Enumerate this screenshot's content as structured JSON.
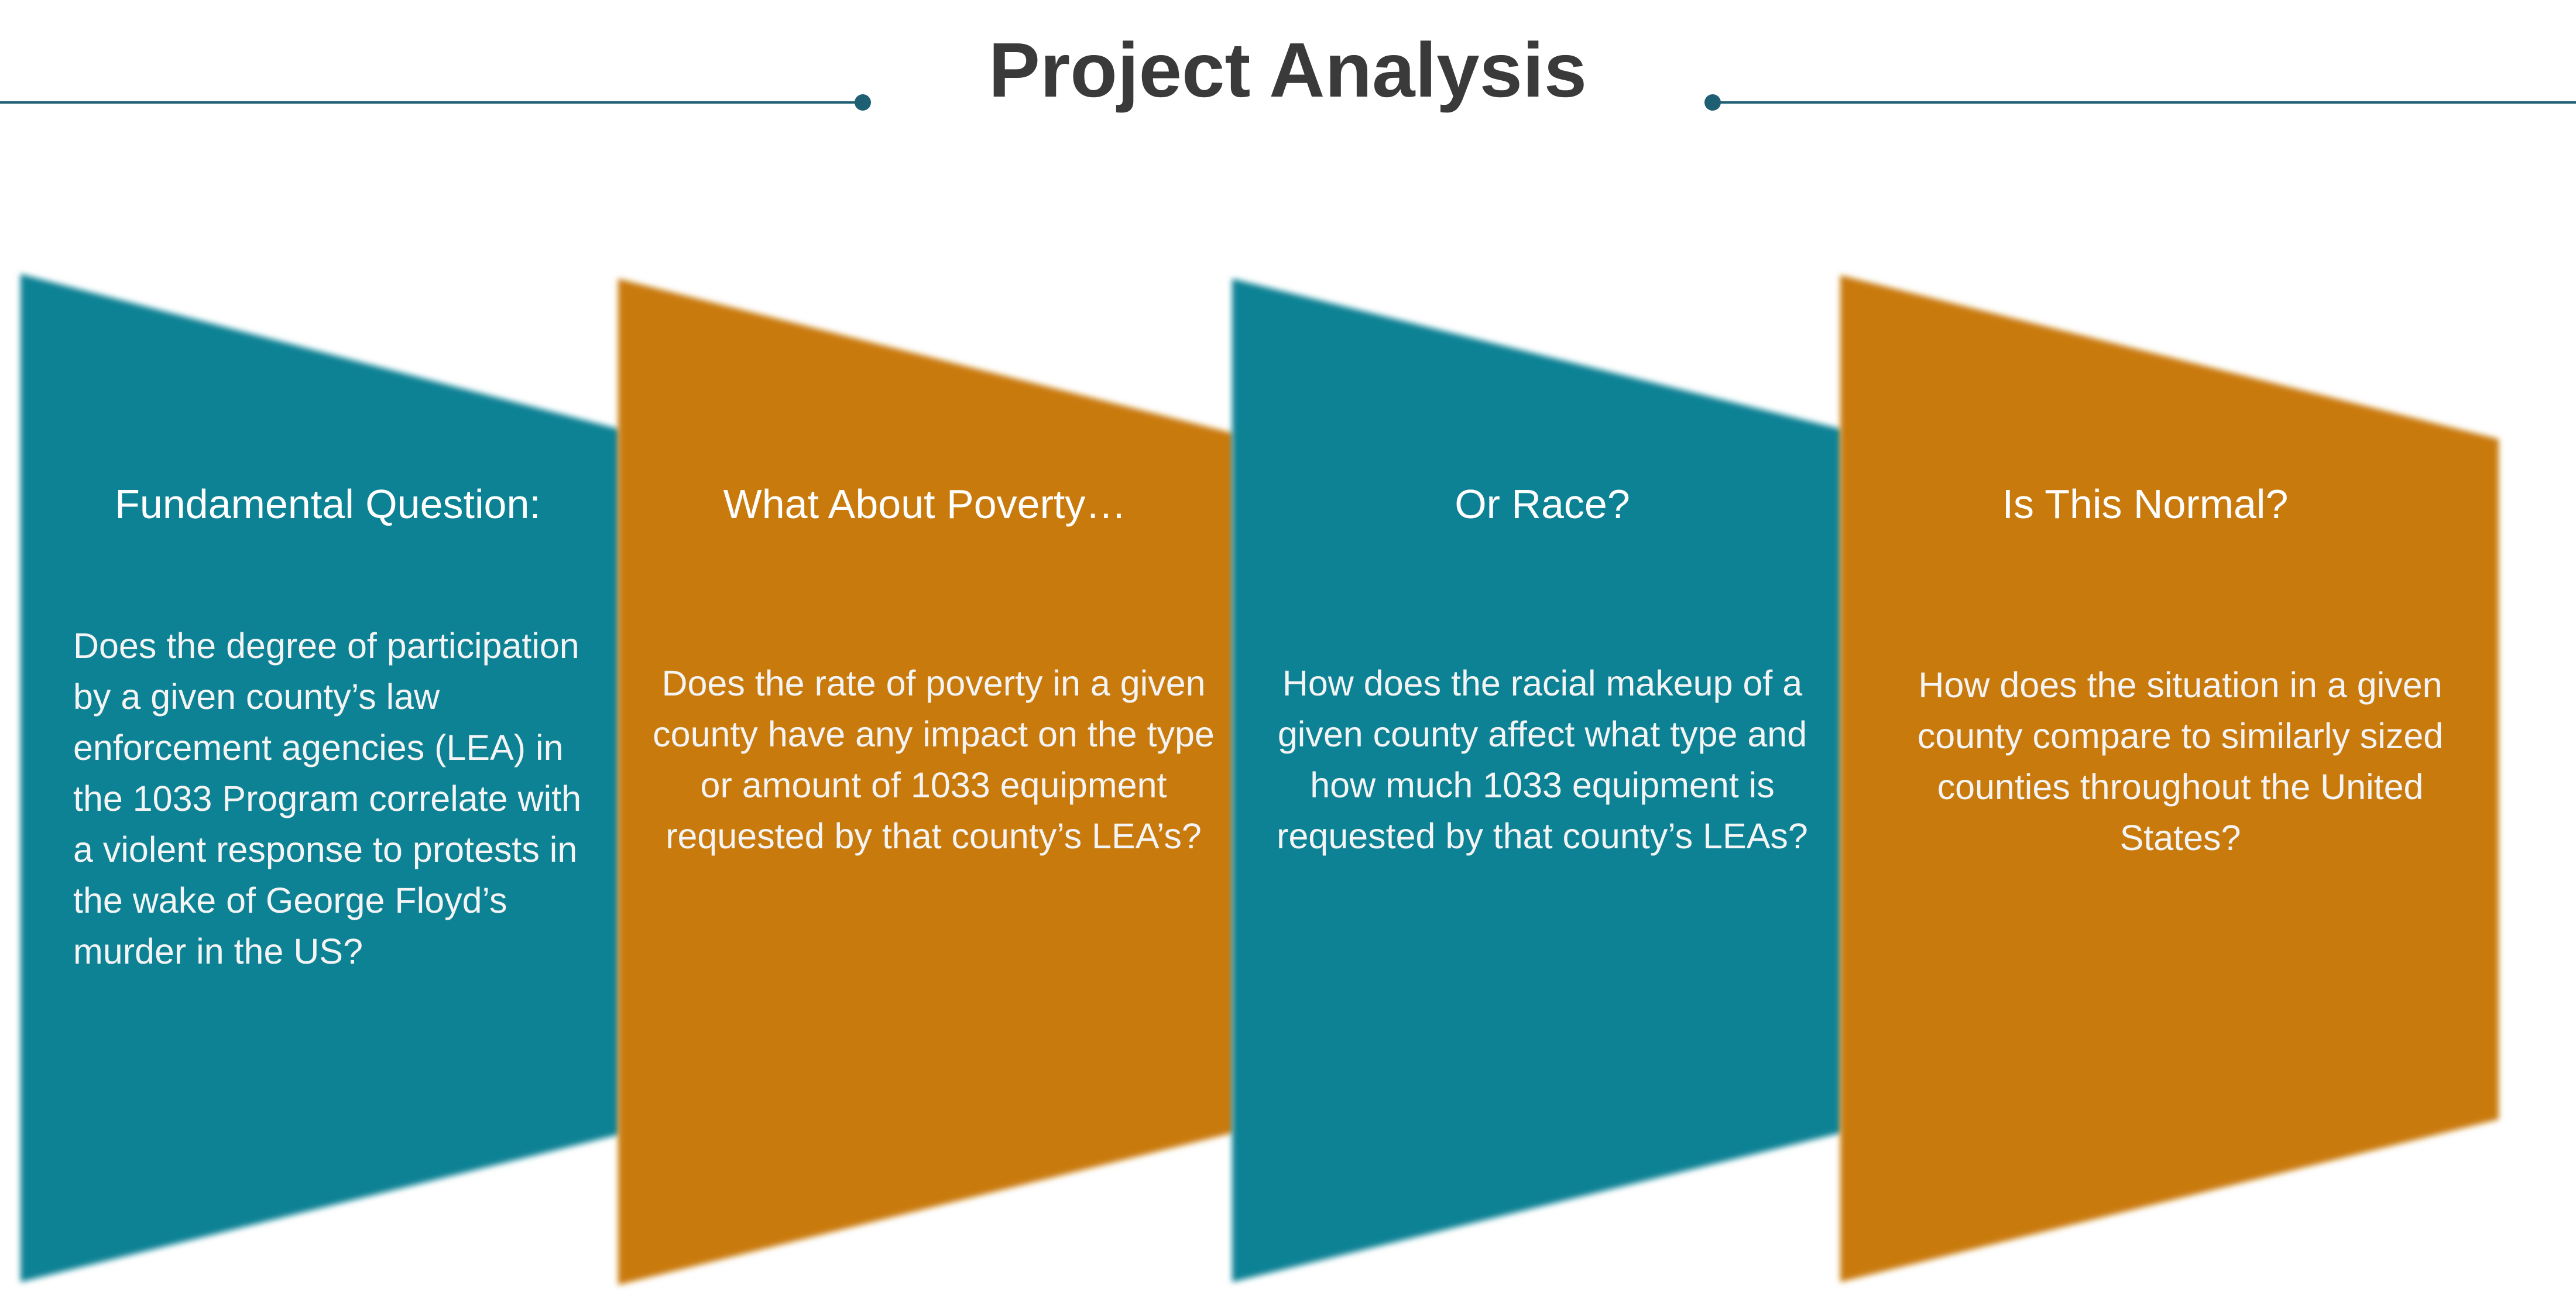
{
  "title": "Project Analysis",
  "colors": {
    "teal": "#0f8294",
    "orange": "#c97a0c",
    "rule": "#1f5f73",
    "title_text": "#3a3a3a"
  },
  "panels": [
    {
      "heading": "Fundamental Question:",
      "body": "Does the degree of participation by  a given county’s law enforcement agencies (LEA) in the 1033 Program correlate with a violent response to protests in the wake of George Floyd’s murder in the US?",
      "color": "teal"
    },
    {
      "heading": "What About Poverty…",
      "body": "Does the rate of poverty in a given county have any impact on the type or amount of 1033 equipment requested by that county’s LEA’s?",
      "color": "orange"
    },
    {
      "heading": "Or Race?",
      "body": "How does the racial makeup of a given county affect what type and how much  1033 equipment is requested by that county’s LEAs?",
      "color": "teal"
    },
    {
      "heading": "Is This Normal?",
      "body": "How does the situation in a given county compare to similarly sized counties throughout the United States?",
      "color": "orange"
    }
  ]
}
